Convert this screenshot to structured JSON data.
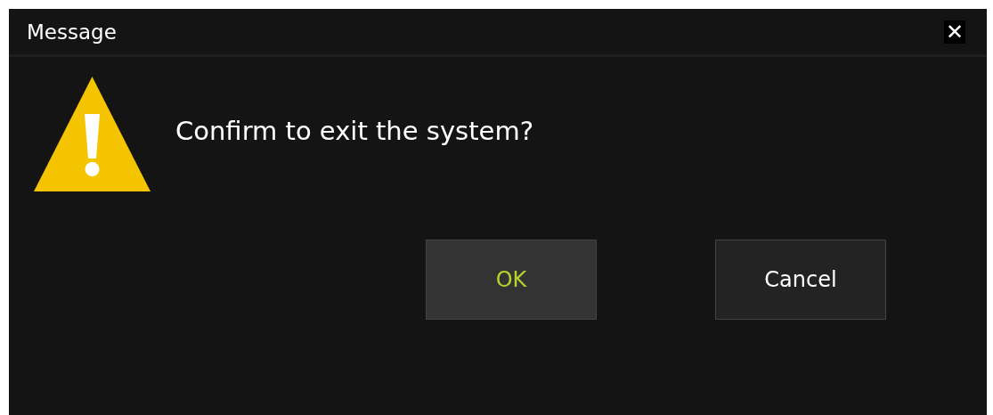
{
  "window": {
    "title": "Message",
    "close_glyph": "✕"
  },
  "message": {
    "kind": "warning",
    "text": "Confirm to exit the system?"
  },
  "buttons": [
    {
      "label": "OK",
      "focused": true
    },
    {
      "label": "Cancel",
      "focused": false
    }
  ]
}
